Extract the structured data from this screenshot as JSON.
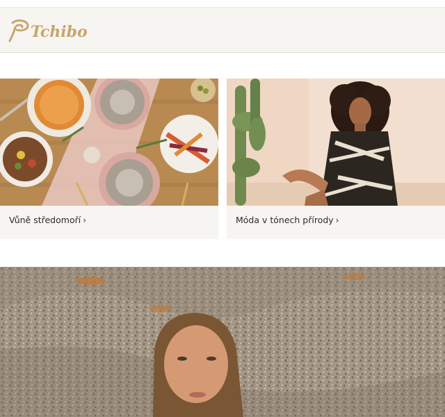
{
  "header": {
    "brand": "Tchibo",
    "logo_color": "#c9a56a"
  },
  "cards": [
    {
      "caption": "Vůně středomoří",
      "chevron": "›"
    },
    {
      "caption": "Móda v tónech přírody",
      "chevron": "›"
    }
  ],
  "colors": {
    "header_bg": "#f7f5f1",
    "card_bg": "#f7f5f1",
    "text": "#2b2b2b"
  }
}
